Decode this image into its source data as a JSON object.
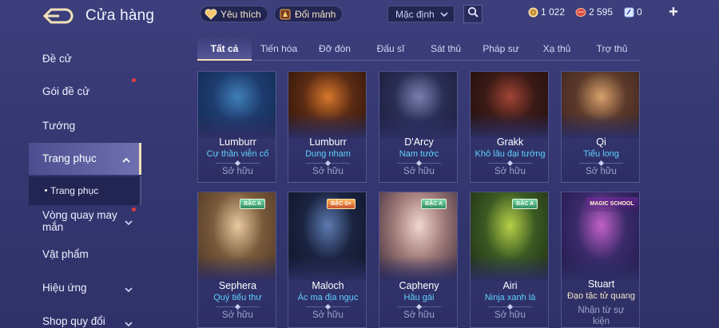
{
  "header": {
    "title": "Cửa hàng",
    "favorites_label": "Yêu thích",
    "exchange_label": "Đổi mảnh",
    "sort_value": "Mặc định",
    "currency_gold": "1 022",
    "currency_red": "2 595",
    "currency_voucher": "0",
    "add_label": "+"
  },
  "sidebar": {
    "items": [
      {
        "label": "Đề cử"
      },
      {
        "label": "Gói đề cử"
      },
      {
        "label": "Tướng"
      },
      {
        "label": "Trang phục"
      },
      {
        "label": "Trang phục"
      },
      {
        "label": "Vòng quay may mắn"
      },
      {
        "label": "Vật phẩm"
      },
      {
        "label": "Hiệu ứng"
      },
      {
        "label": "Shop quy đổi"
      }
    ]
  },
  "tabs": [
    {
      "label": "Tất cả"
    },
    {
      "label": "Tiến hóa"
    },
    {
      "label": "Đỡ đòn"
    },
    {
      "label": "Đấu sĩ"
    },
    {
      "label": "Sát thủ"
    },
    {
      "label": "Pháp sư"
    },
    {
      "label": "Xạ thủ"
    },
    {
      "label": "Trợ thủ"
    }
  ],
  "cards": [
    {
      "hero": "Lumburr",
      "skin": "Cự thần viễn cổ",
      "status": "Sở hữu",
      "colors": [
        "#1d3b6e",
        "#3f7fb8",
        "#0f2a4f"
      ]
    },
    {
      "hero": "Lumburr",
      "skin": "Dung nham",
      "status": "Sở hữu",
      "colors": [
        "#5a2a12",
        "#d7782c",
        "#2a140a"
      ]
    },
    {
      "hero": "D'Arcy",
      "skin": "Nam tước",
      "status": "Sở hữu",
      "colors": [
        "#2a2e55",
        "#7a7fb0",
        "#1a1b38"
      ]
    },
    {
      "hero": "Grakk",
      "skin": "Khô lâu đại tướng",
      "status": "Sở hữu",
      "colors": [
        "#3a1a16",
        "#a04434",
        "#1f0e0c"
      ]
    },
    {
      "hero": "Qi",
      "skin": "Tiểu long",
      "status": "Sở hữu",
      "colors": [
        "#5c3a2a",
        "#d7a06c",
        "#3a2220"
      ]
    },
    {
      "hero": "Sephera",
      "skin": "Quý tiểu thư",
      "status": "Sở hữu",
      "badge": "BẬC A",
      "colors": [
        "#7a5a3a",
        "#e8c9a0",
        "#4a3324"
      ]
    },
    {
      "hero": "Maloch",
      "skin": "Ác ma địa ngục",
      "status": "Sở hữu",
      "badge": "BẬC S+",
      "colors": [
        "#1a2340",
        "#5c7ab0",
        "#0e1428"
      ]
    },
    {
      "hero": "Capheny",
      "skin": "Hầu gái",
      "status": "Sở hữu",
      "badge": "BẬC A",
      "colors": [
        "#a07a78",
        "#f1d6d0",
        "#3a2a3a"
      ]
    },
    {
      "hero": "Airi",
      "skin": "Ninja xanh lá",
      "status": "Sở hữu",
      "badge": "BẬC A",
      "colors": [
        "#3a5a22",
        "#b8d048",
        "#1e2a14"
      ]
    },
    {
      "hero": "Stuart",
      "skin": "Đạo tặc tử quang",
      "status": "Nhận từ sự kiện",
      "badge_text": "MAGIC SCHOOL",
      "colors": [
        "#3a2a6a",
        "#c060c8",
        "#20184a"
      ]
    }
  ],
  "colors": {
    "accent": "#f3e2b8",
    "skin_text": "#5fd1ff",
    "background": "#353872"
  }
}
